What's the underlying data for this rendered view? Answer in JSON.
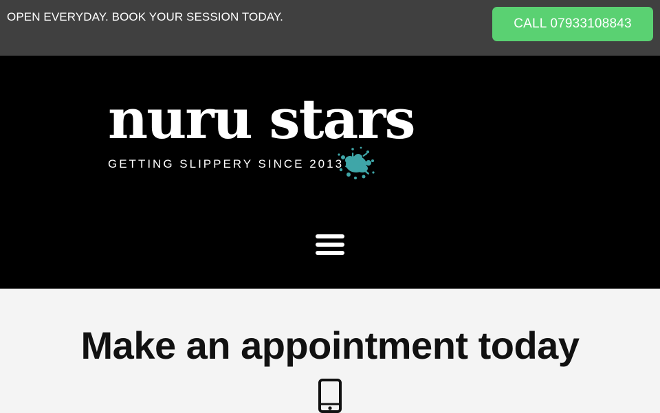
{
  "topbar": {
    "announcement": "OPEN EVERYDAY. BOOK YOUR SESSION TODAY.",
    "call_label": "CALL 07933108843",
    "call_button_color": "#5ad172",
    "background_color": "#404040"
  },
  "header": {
    "brand_name": "nuru stars",
    "tagline": "GETTING SLIPPERY SINCE 2013",
    "splat_color": "#3fa6a8",
    "menu_icon": "hamburger-menu-icon",
    "background_color": "#000000"
  },
  "main": {
    "heading": "Make an appointment today",
    "icon": "mobile-phone-icon"
  }
}
